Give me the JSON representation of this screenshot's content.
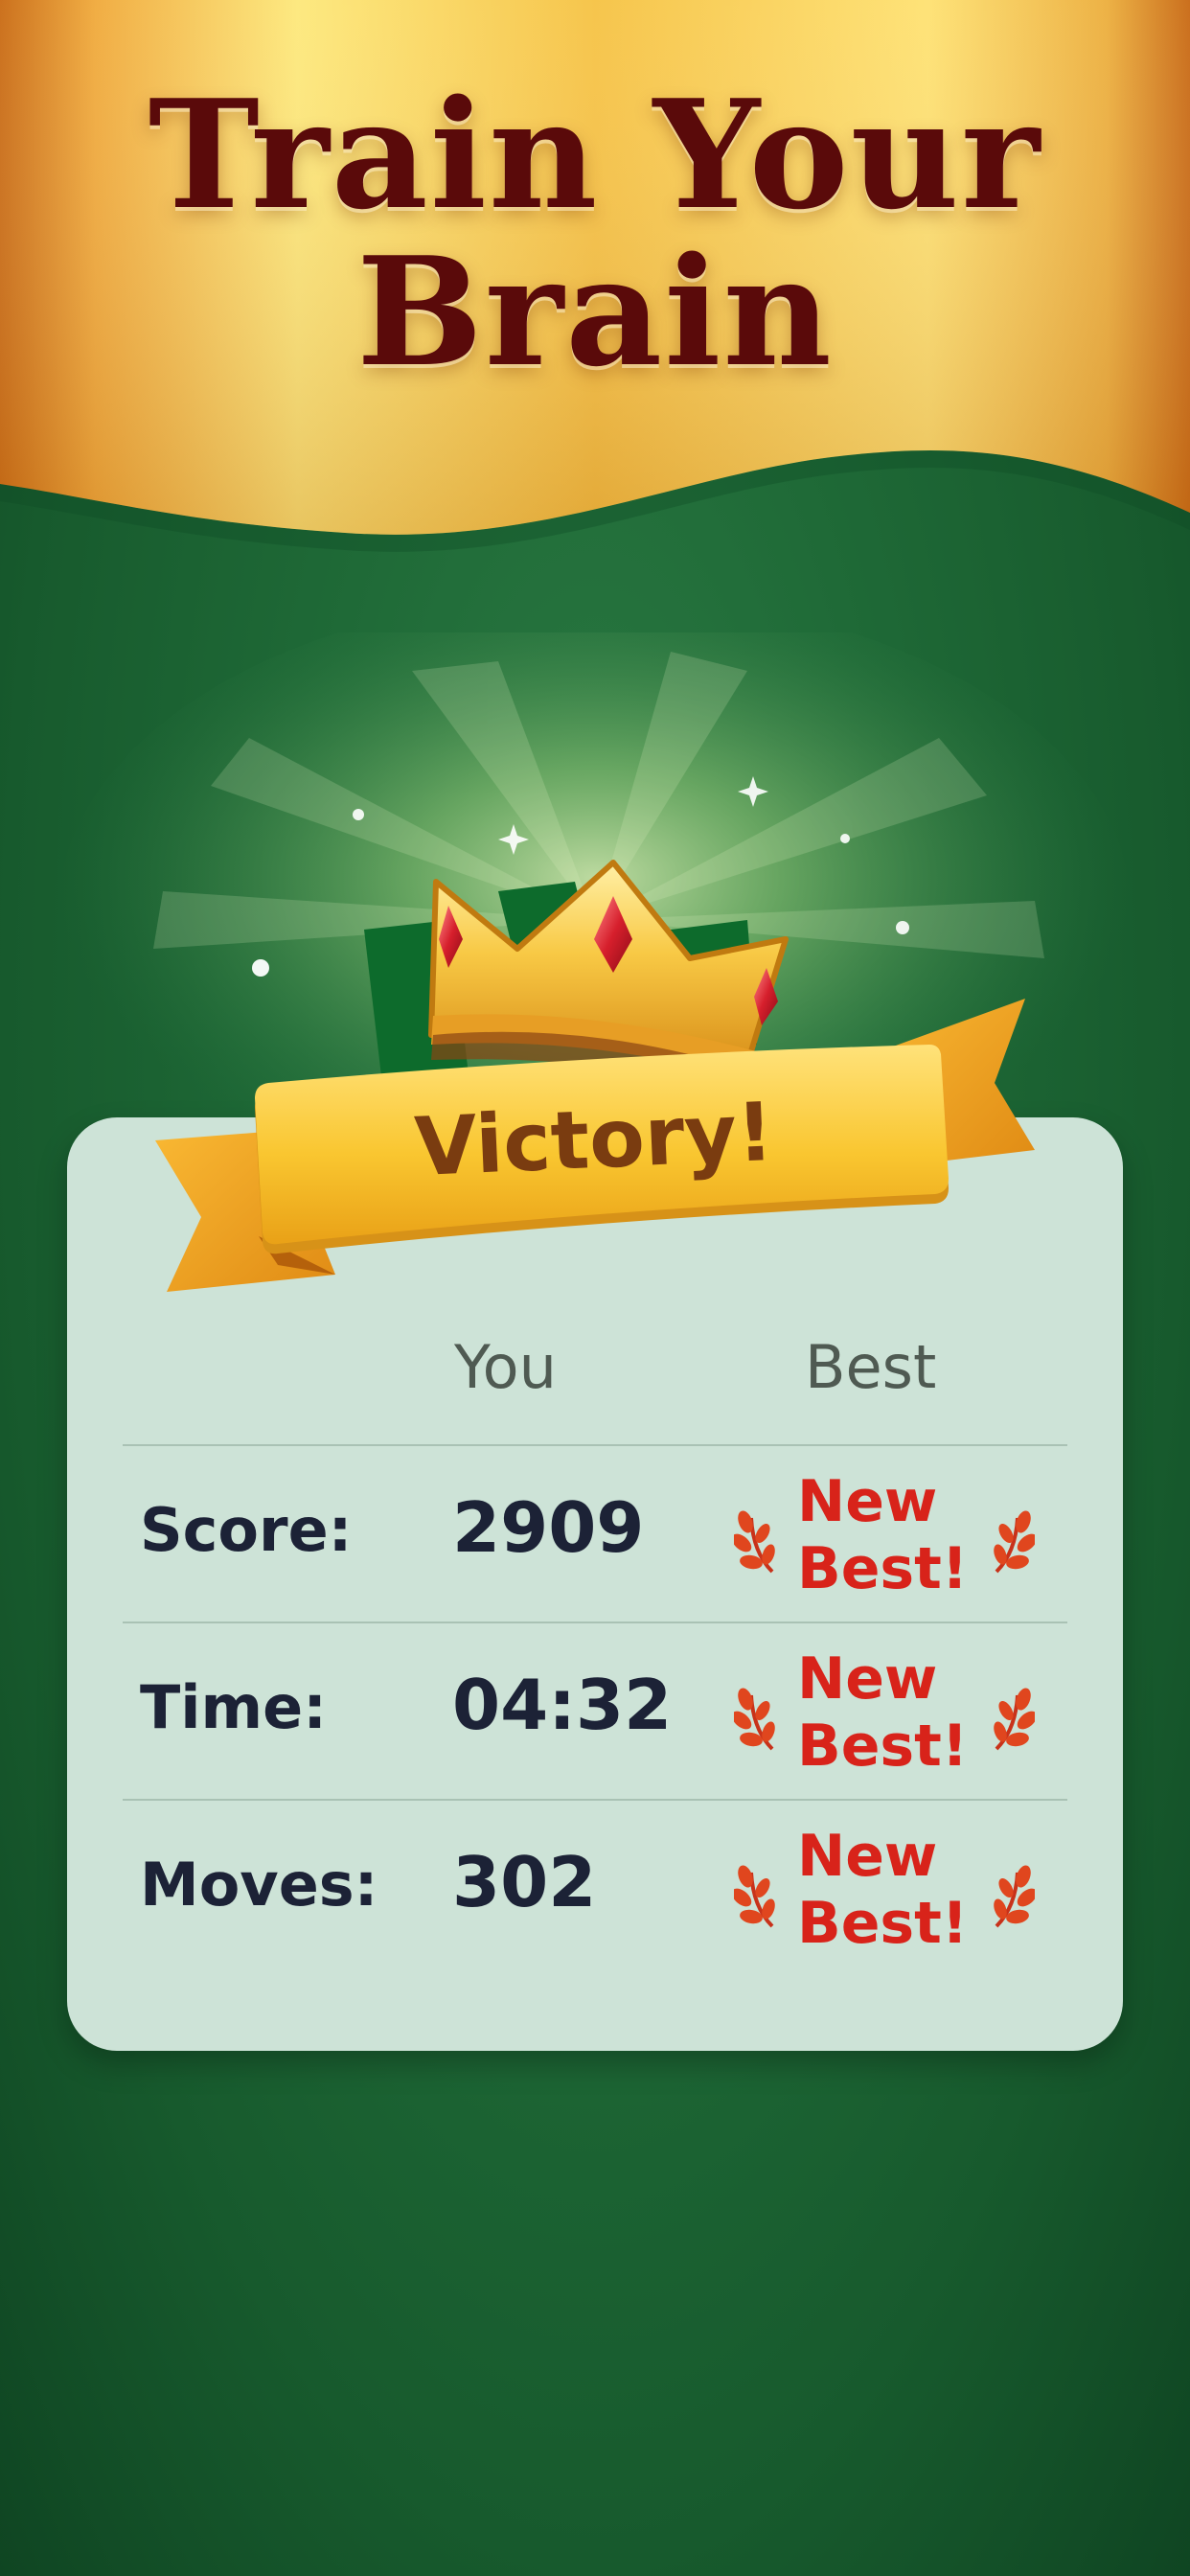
{
  "header": {
    "title_line1": "Train Your",
    "title_line2": "Brain"
  },
  "result": {
    "banner_label": "Victory!"
  },
  "stats": {
    "col_you": "You",
    "col_best": "Best",
    "rows": [
      {
        "label": "Score:",
        "value": "2909",
        "best": "New Best!"
      },
      {
        "label": "Time:",
        "value": "04:32",
        "best": "New Best!"
      },
      {
        "label": "Moves:",
        "value": "302",
        "best": "New Best!"
      }
    ]
  },
  "colors": {
    "felt_green": "#1f6a37",
    "gold": "#f7c531",
    "title_maroon": "#5a0a0a",
    "card_bg": "#cde3d7",
    "new_best_red": "#d8231a",
    "ribbon_text": "#7a3c10"
  },
  "icons": {
    "crown": "crown-icon",
    "laurel": "laurel-icon",
    "sparkle": "sparkle-icon"
  }
}
